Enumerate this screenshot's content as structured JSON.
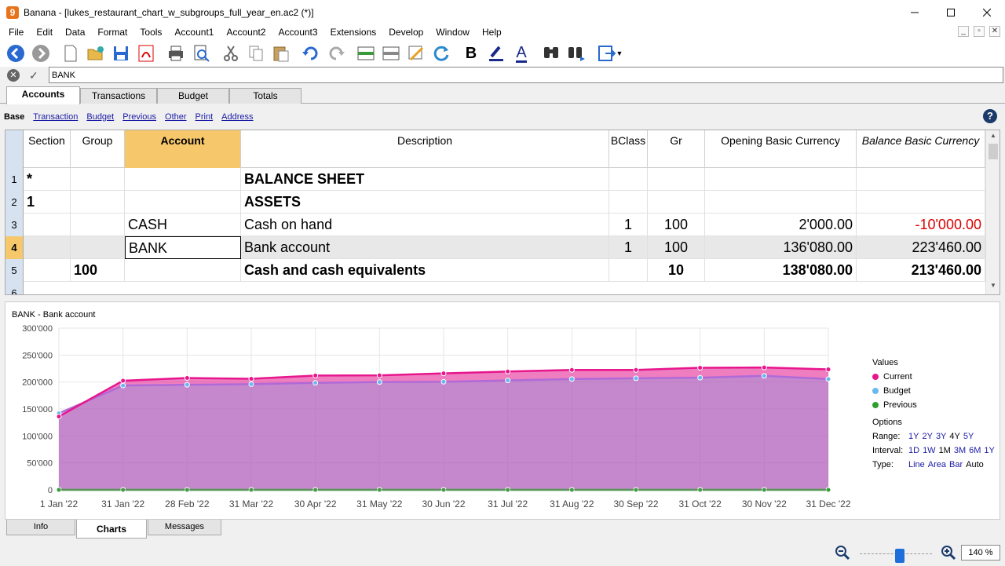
{
  "window": {
    "title": "Banana - [lukes_restaurant_chart_w_subgroups_full_year_en.ac2 (*)]",
    "logo": "9"
  },
  "menu": [
    "File",
    "Edit",
    "Data",
    "Format",
    "Tools",
    "Account1",
    "Account2",
    "Account3",
    "Extensions",
    "Develop",
    "Window",
    "Help"
  ],
  "toolbar": {
    "icons": [
      "back-icon",
      "forward-icon",
      "new-file-icon",
      "open-icon",
      "save-icon",
      "pdf-icon",
      "print-icon",
      "print-preview-icon",
      "cut-icon",
      "copy-icon",
      "paste-icon",
      "undo-icon",
      "redo-icon",
      "insert-rows-icon",
      "delete-rows-icon",
      "edit-icon",
      "recheck-icon",
      "bold-icon",
      "highlight-icon",
      "font-color-icon",
      "find-icon",
      "find-next-icon",
      "export-icon"
    ],
    "bold_glyph": "B",
    "font_color_glyph": "A"
  },
  "formula_bar": {
    "value": "BANK"
  },
  "table_tabs": [
    "Accounts",
    "Transactions",
    "Budget",
    "Totals"
  ],
  "views": [
    "Base",
    "Transaction",
    "Budget",
    "Previous",
    "Other",
    "Print",
    "Address"
  ],
  "grid": {
    "columns": [
      "Section",
      "Group",
      "Account",
      "Description",
      "BClass",
      "Gr",
      "Opening Basic Currency",
      "Balance Basic Currency"
    ],
    "rows": [
      {
        "n": "1",
        "section": "*",
        "group": "",
        "account": "",
        "description": "BALANCE SHEET",
        "bclass": "",
        "gr": "",
        "opening": "",
        "balance": ""
      },
      {
        "n": "2",
        "section": "1",
        "group": "",
        "account": "",
        "description": "ASSETS",
        "bclass": "",
        "gr": "",
        "opening": "",
        "balance": ""
      },
      {
        "n": "3",
        "section": "",
        "group": "",
        "account": "CASH",
        "description": "Cash on hand",
        "bclass": "1",
        "gr": "100",
        "opening": "2'000.00",
        "balance": "-10'000.00"
      },
      {
        "n": "4",
        "section": "",
        "group": "",
        "account": "BANK",
        "description": "Bank account",
        "bclass": "1",
        "gr": "100",
        "opening": "136'080.00",
        "balance": "223'460.00"
      },
      {
        "n": "5",
        "section": "",
        "group": "100",
        "account": "",
        "description": "Cash and cash equivalents",
        "bclass": "",
        "gr": "10",
        "opening": "138'080.00",
        "balance": "213'460.00"
      },
      {
        "n": "6",
        "section": "",
        "group": "",
        "account": "",
        "description": "",
        "bclass": "",
        "gr": "",
        "opening": "",
        "balance": ""
      }
    ]
  },
  "chart_panel": {
    "title": "BANK - Bank account",
    "legend_title": "Values",
    "options_title": "Options",
    "range_label": "Range:",
    "range_options": [
      "1Y",
      "2Y",
      "3Y",
      "4Y",
      "5Y"
    ],
    "interval_label": "Interval:",
    "interval_options": [
      "1D",
      "1W",
      "1M",
      "3M",
      "6M",
      "1Y"
    ],
    "type_label": "Type:",
    "type_options": [
      "Line",
      "Area",
      "Bar",
      "Auto"
    ]
  },
  "chart_data": {
    "type": "area",
    "x": [
      "1 Jan '22",
      "31 Jan '22",
      "28 Feb '22",
      "31 Mar '22",
      "30 Apr '22",
      "31 May '22",
      "30 Jun '22",
      "31 Jul '22",
      "31 Aug '22",
      "30 Sep '22",
      "31 Oct '22",
      "30 Nov '22",
      "31 Dec '22"
    ],
    "y_ticks": [
      "0",
      "50'000",
      "100'000",
      "150'000",
      "200'000",
      "250'000",
      "300'000"
    ],
    "ylim": [
      0,
      300000
    ],
    "grid": true,
    "legend_position": "right",
    "series": [
      {
        "name": "Current",
        "color": "#e8168c",
        "values": [
          136080,
          202500,
          207500,
          206000,
          212000,
          212500,
          216000,
          219500,
          222500,
          222500,
          226500,
          227000,
          223460
        ]
      },
      {
        "name": "Budget",
        "color": "#6ab8f0",
        "values": [
          142000,
          193500,
          195000,
          196000,
          198500,
          200000,
          200500,
          203000,
          205500,
          207000,
          208000,
          211500,
          205500
        ]
      },
      {
        "name": "Previous",
        "color": "#2ca02c",
        "values": [
          0,
          0,
          0,
          0,
          0,
          0,
          0,
          0,
          0,
          0,
          0,
          0,
          0
        ]
      }
    ]
  },
  "bottom_tabs": [
    "Info",
    "Charts",
    "Messages"
  ],
  "zoom": {
    "value": "140 %"
  }
}
